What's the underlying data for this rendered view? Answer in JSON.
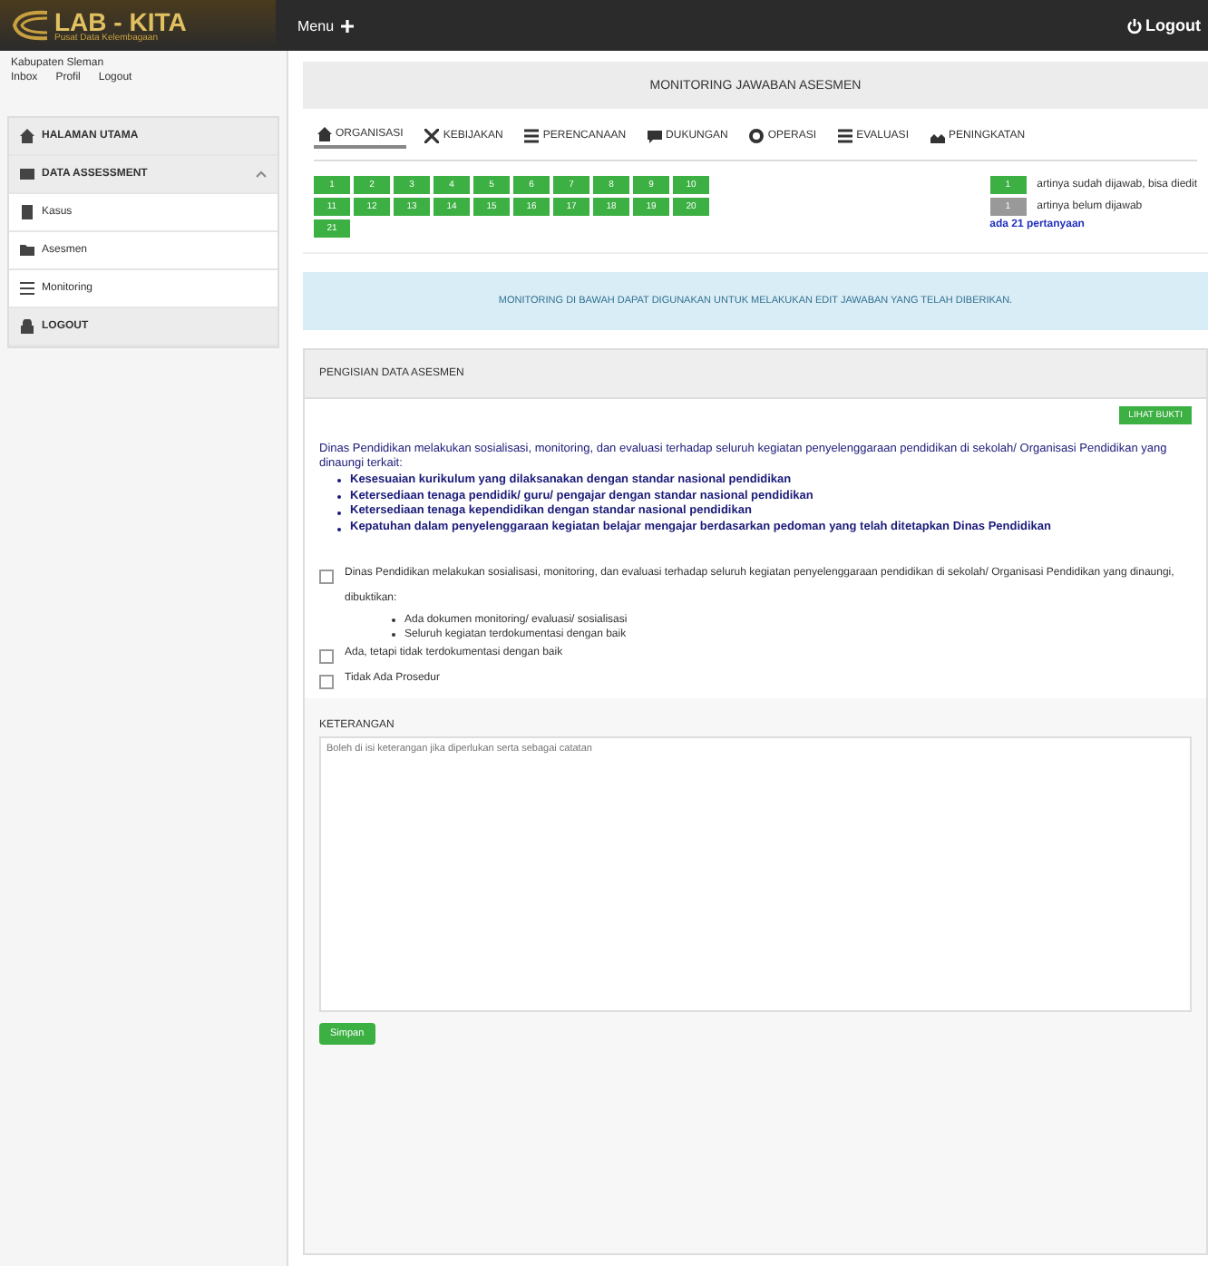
{
  "topbar": {
    "logo": "LAB - KITA",
    "tagline": "Pusat Data Kelembagaan",
    "menu": "Menu",
    "logout": "Logout"
  },
  "sidebar": {
    "region": "Kabupaten Sleman",
    "links": [
      "Inbox",
      "Profil",
      "Logout"
    ],
    "items": [
      {
        "label": "HALAMAN UTAMA",
        "kind": "section"
      },
      {
        "label": "DATA ASSESSMENT",
        "kind": "group"
      },
      {
        "label": "Kasus",
        "kind": "sub"
      },
      {
        "label": "Asesmen",
        "kind": "sub"
      },
      {
        "label": "Monitoring",
        "kind": "sub"
      },
      {
        "label": "LOGOUT",
        "kind": "section"
      }
    ]
  },
  "page_title": "MONITORING JAWABAN ASESMEN",
  "tabs": [
    {
      "label": "ORGANISASI",
      "selected": true
    },
    {
      "label": "KEBIJAKAN",
      "selected": false
    },
    {
      "label": "PERENCANAAN",
      "selected": false
    },
    {
      "label": "DUKUNGAN",
      "selected": false
    },
    {
      "label": "OPERASI",
      "selected": false
    },
    {
      "label": "EVALUASI",
      "selected": false
    },
    {
      "label": "PENINGKATAN",
      "selected": false
    }
  ],
  "questions": [
    {
      "label": "1",
      "answered": true
    },
    {
      "label": "2",
      "answered": true
    },
    {
      "label": "3",
      "answered": true
    },
    {
      "label": "4",
      "answered": true
    },
    {
      "label": "5",
      "answered": true
    },
    {
      "label": "6",
      "answered": true
    },
    {
      "label": "7",
      "answered": true
    },
    {
      "label": "8",
      "answered": true
    },
    {
      "label": "9",
      "answered": true
    },
    {
      "label": "10",
      "answered": true
    },
    {
      "label": "11",
      "answered": true
    },
    {
      "label": "12",
      "answered": true
    },
    {
      "label": "13",
      "answered": true
    },
    {
      "label": "14",
      "answered": true
    },
    {
      "label": "15",
      "answered": true
    },
    {
      "label": "16",
      "answered": true
    },
    {
      "label": "17",
      "answered": true
    },
    {
      "label": "18",
      "answered": true
    },
    {
      "label": "19",
      "answered": true
    },
    {
      "label": "20",
      "answered": true
    },
    {
      "label": "21",
      "answered": true
    }
  ],
  "legend": [
    {
      "label": "1",
      "answered": true,
      "text": "artinya sudah dijawab, bisa diedit"
    },
    {
      "label": "1",
      "answered": false,
      "text": "artinya belum dijawab"
    }
  ],
  "question_count": "ada 21 pertanyaan",
  "notice": "MONITORING DI BAWAH DAPAT DIGUNAKAN UNTUK MELAKUKAN EDIT JAWABAN YANG TELAH DIBERIKAN.",
  "form": {
    "title": "PENGISIAN DATA ASESMEN",
    "action": "LIHAT BUKTI",
    "question": "Dinas Pendidikan melakukan sosialisasi, monitoring, dan evaluasi terhadap seluruh kegiatan penyelenggaraan pendidikan di sekolah/ Organisasi Pendidikan yang dinaungi terkait:",
    "points": [
      "Kesesuaian kurikulum yang dilaksanakan dengan standar nasional pendidikan",
      "Ketersediaan tenaga pendidik/ guru/ pengajar dengan standar nasional pendidikan",
      "Ketersediaan tenaga kependidikan dengan standar nasional pendidikan",
      "Kepatuhan dalam penyelenggaraan kegiatan belajar mengajar berdasarkan pedoman yang telah ditetapkan Dinas Pendidikan"
    ],
    "options": [
      {
        "text": "Dinas Pendidikan melakukan sosialisasi, monitoring, dan evaluasi terhadap seluruh kegiatan penyelenggaraan pendidikan di sekolah/ Organisasi Pendidikan yang dinaungi, dibuktikan:",
        "checked": false,
        "points": [
          "Ada dokumen monitoring/ evaluasi/ sosialisasi",
          "Seluruh kegiatan terdokumentasi dengan baik"
        ]
      },
      {
        "text": "Ada, tetapi tidak terdokumentasi dengan baik",
        "checked": false
      },
      {
        "text": "Tidak Ada Prosedur",
        "checked": false
      }
    ],
    "note_label": "KETERANGAN",
    "note_placeholder": "Boleh di isi keterangan jika diperlukan serta sebagai catatan",
    "save": "Simpan"
  }
}
